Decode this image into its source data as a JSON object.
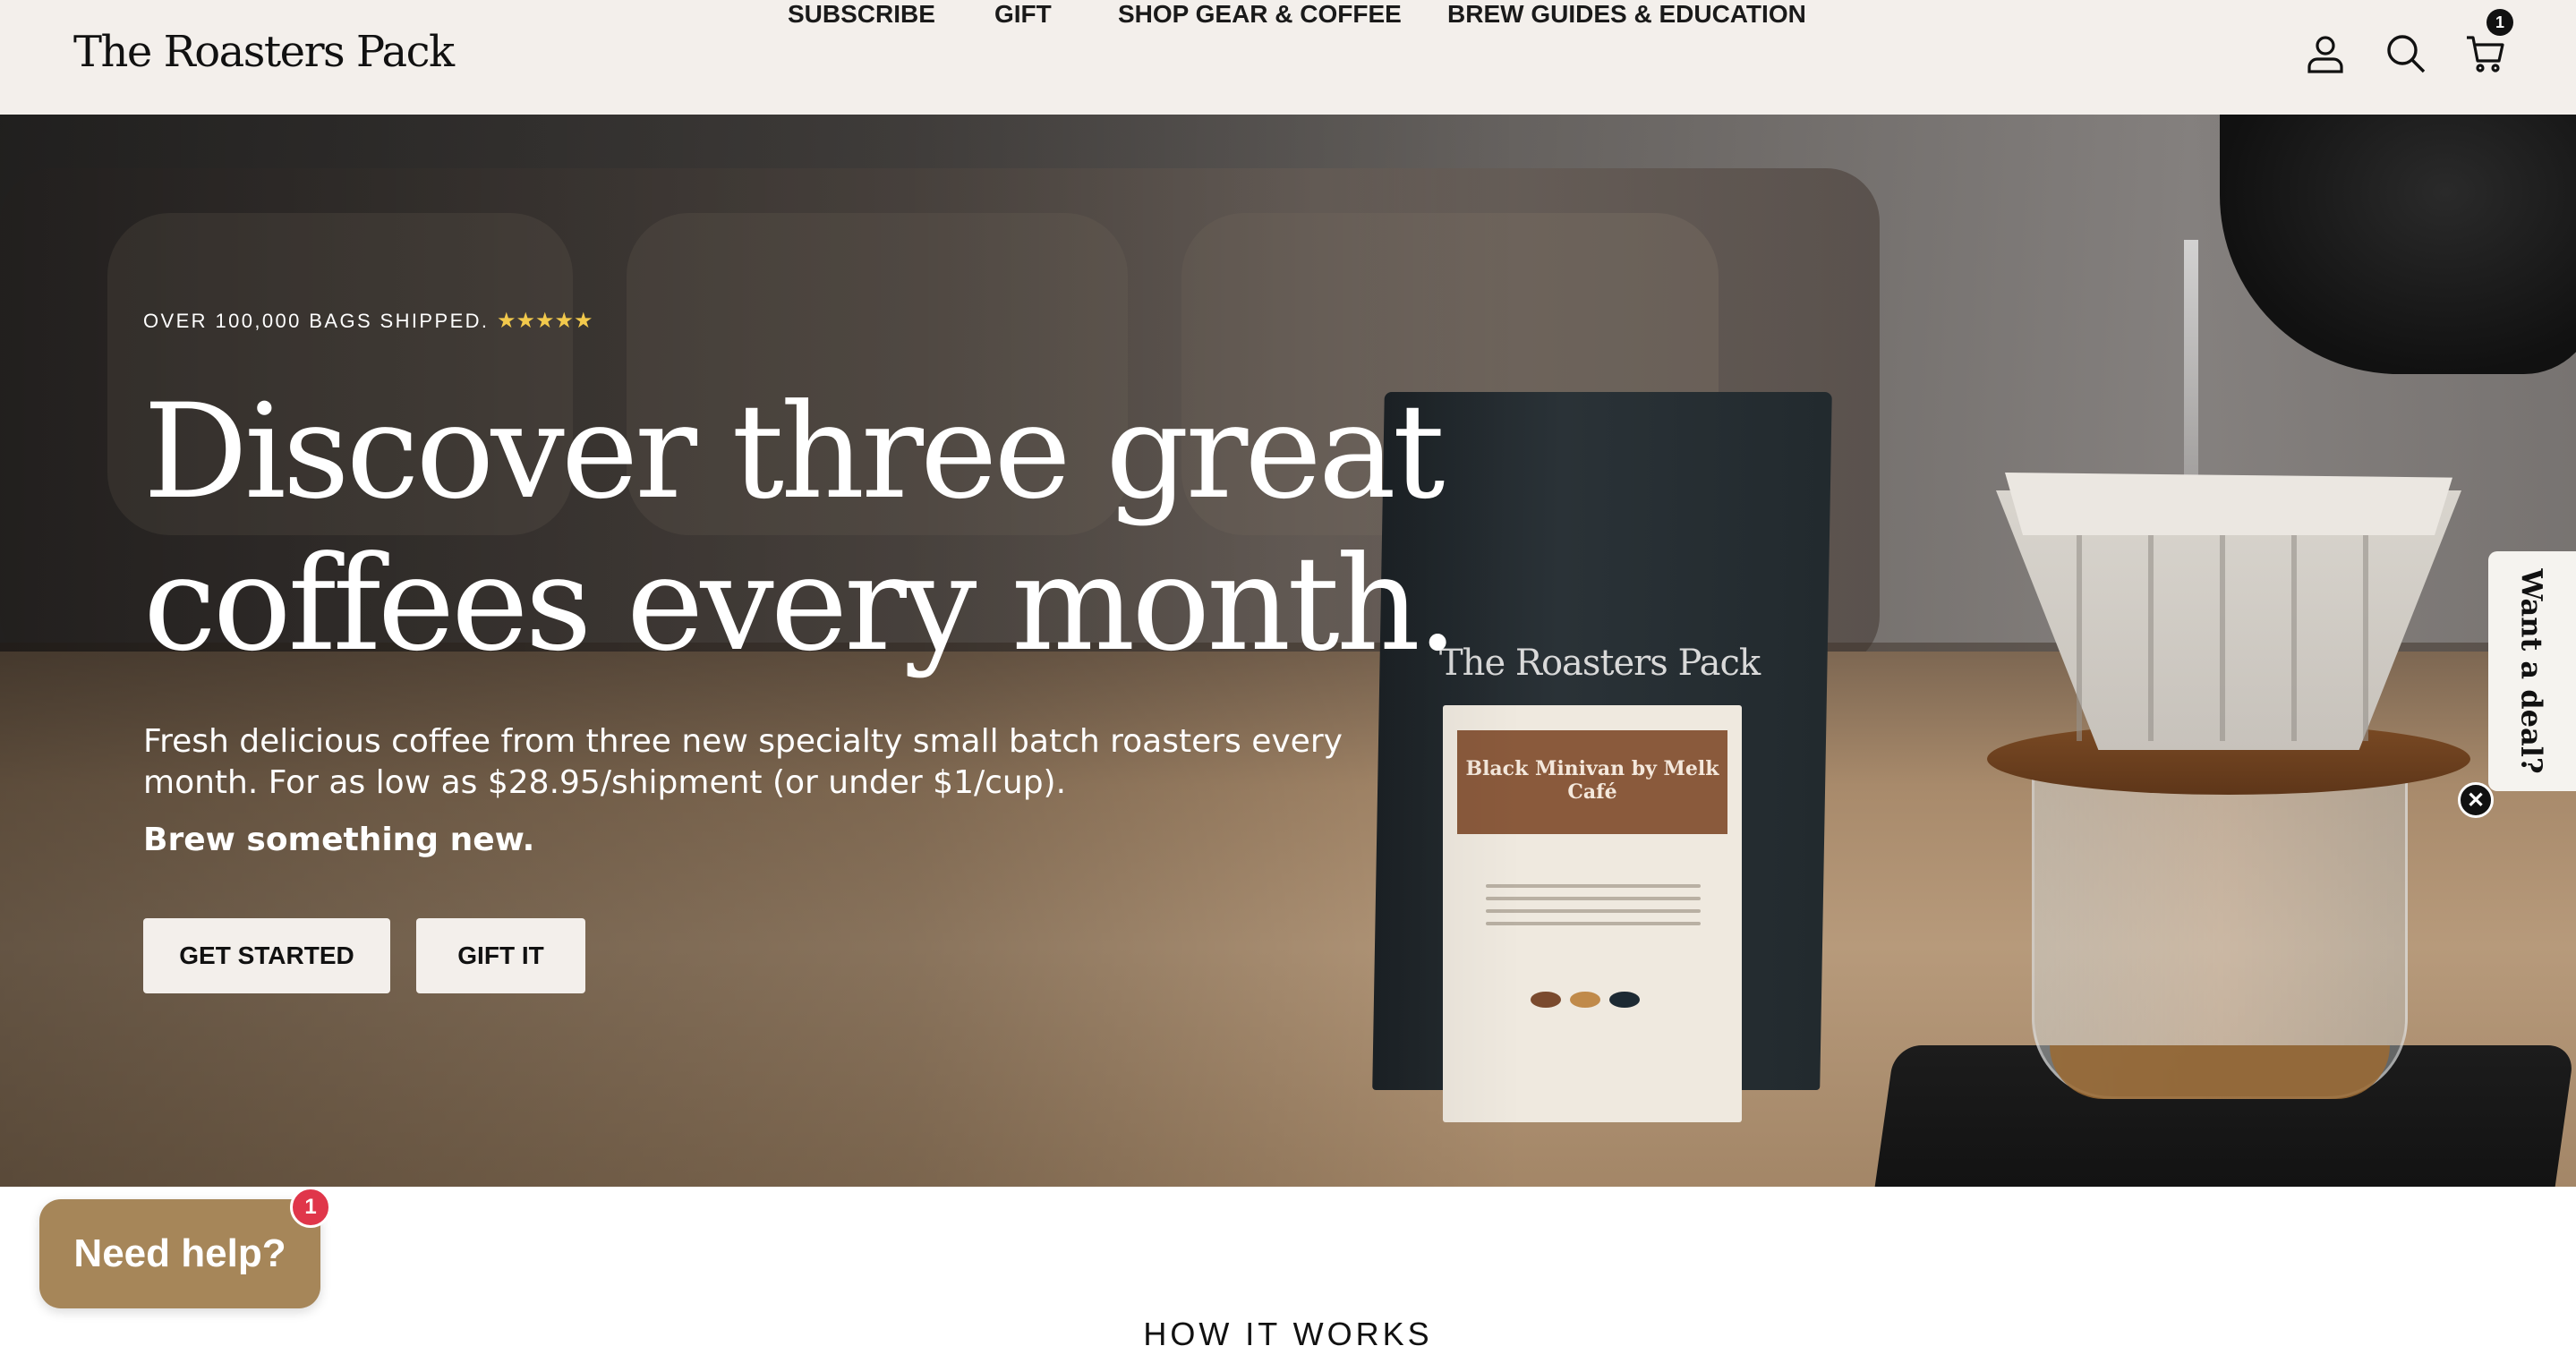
{
  "header": {
    "logo": "The Roasters Pack",
    "nav": [
      {
        "label": "SUBSCRIBE"
      },
      {
        "label": "GIFT"
      },
      {
        "label": "SHOP GEAR & COFFEE"
      },
      {
        "label": "BREW GUIDES & EDUCATION"
      }
    ],
    "icons": [
      "account-icon",
      "search-icon",
      "cart-icon"
    ],
    "cart_count": "1"
  },
  "hero": {
    "eyebrow": "OVER 100,000 BAGS SHIPPED.",
    "stars": "★★★★★",
    "headline": "Discover three great coffees every month.",
    "subtext": "Fresh delicious coffee from three new specialty small batch roasters every month. For as low as $28.95/shipment (or under $1/cup).",
    "tagline": "Brew something new.",
    "buttons": {
      "primary": "GET STARTED",
      "secondary": "GIFT IT"
    },
    "bag": {
      "brand": "The Roasters Pack",
      "label": "Black Minivan by Melk Café"
    }
  },
  "deal_tab": {
    "label": "Want a deal?",
    "close": "✕"
  },
  "section": {
    "title": "HOW IT WORKS"
  },
  "help": {
    "label": "Need help?",
    "badge": "1"
  },
  "colors": {
    "header_bg": "#f3efeb",
    "help_bg": "#a68659",
    "badge_red": "#e0364a",
    "stars": "#f2c94c"
  }
}
